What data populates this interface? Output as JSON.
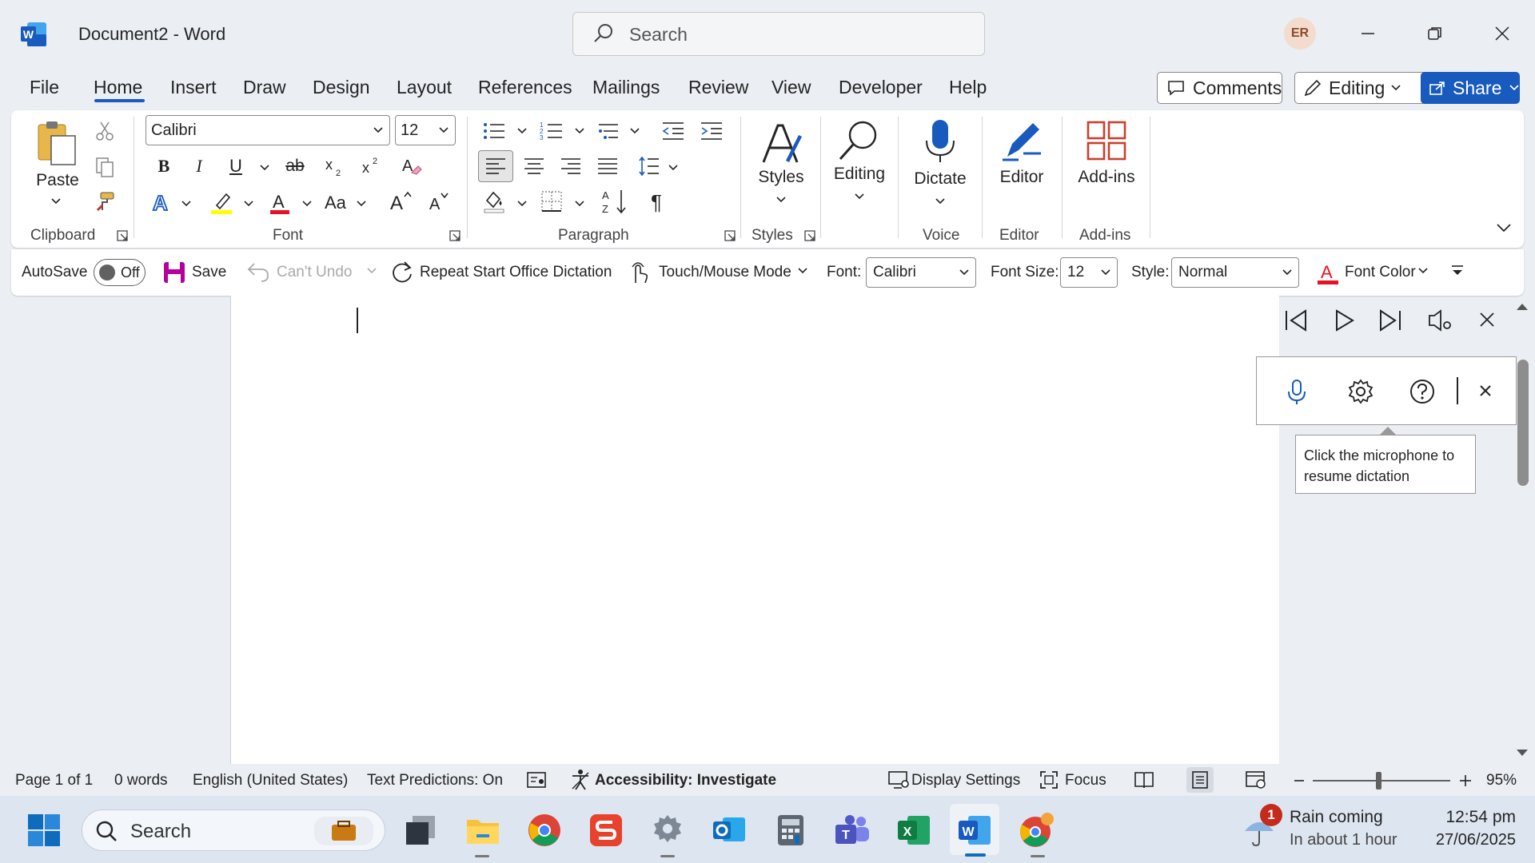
{
  "title_bar": {
    "doc_title": "Document2  -  Word",
    "search_placeholder": "Search",
    "avatar_initials": "ER",
    "app_icon": "word-icon"
  },
  "tabs": [
    "File",
    "Home",
    "Insert",
    "Draw",
    "Design",
    "Layout",
    "References",
    "Mailings",
    "Review",
    "View",
    "Developer",
    "Help"
  ],
  "active_tab": "Home",
  "top_buttons": {
    "comments": "Comments",
    "editing": "Editing",
    "share": "Share"
  },
  "ribbon": {
    "clipboard": {
      "paste": "Paste",
      "label": "Clipboard"
    },
    "font": {
      "name": "Calibri",
      "size": "12",
      "label": "Font",
      "change_case": "Aa"
    },
    "paragraph": {
      "label": "Paragraph"
    },
    "styles": {
      "button": "Styles",
      "label": "Styles"
    },
    "editing": {
      "button": "Editing"
    },
    "voice": {
      "button": "Dictate",
      "label": "Voice"
    },
    "editor": {
      "button": "Editor",
      "label": "Editor"
    },
    "addins": {
      "button": "Add-ins",
      "label": "Add-ins"
    }
  },
  "qat": {
    "autosave": "AutoSave",
    "autosave_state": "Off",
    "save": "Save",
    "undo": "Can't Undo",
    "repeat": "Repeat Start Office Dictation",
    "touch": "Touch/Mouse Mode",
    "font_label": "Font:",
    "font_value": "Calibri",
    "size_label": "Font Size:",
    "size_value": "12",
    "style_label": "Style:",
    "style_value": "Normal",
    "font_color": "Font Color"
  },
  "dictation": {
    "tooltip": "Click the microphone to resume dictation"
  },
  "status": {
    "page": "Page 1 of 1",
    "words": "0 words",
    "language": "English (United States)",
    "predictions": "Text Predictions: On",
    "accessibility": "Accessibility: Investigate",
    "display": "Display Settings",
    "focus": "Focus",
    "zoom": "95%"
  },
  "taskbar": {
    "search": "Search",
    "weather_title": "Rain coming",
    "weather_sub": "In about 1 hour",
    "time": "12:54 pm",
    "date": "27/06/2025",
    "badge": "1"
  },
  "colors": {
    "accent": "#185abd",
    "font_red": "#e81123",
    "highlight": "#ffff00"
  }
}
